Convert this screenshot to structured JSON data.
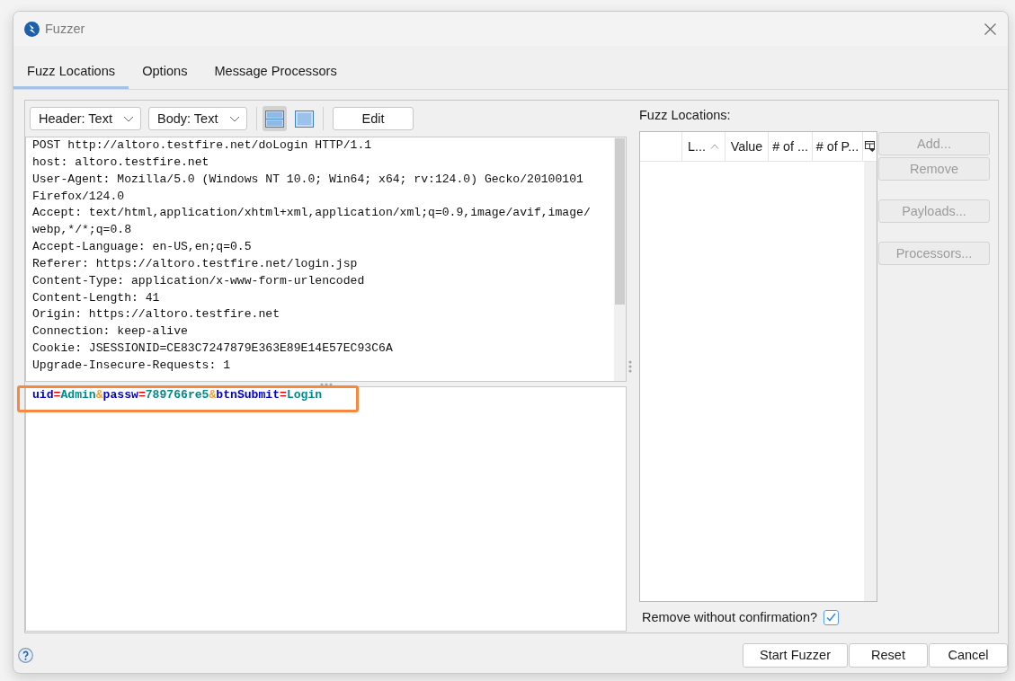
{
  "window": {
    "title": "Fuzzer"
  },
  "tabs": [
    {
      "label": "Fuzz Locations",
      "selected": true
    },
    {
      "label": "Options",
      "selected": false
    },
    {
      "label": "Message Processors",
      "selected": false
    }
  ],
  "toolbar": {
    "dropdowns": [
      {
        "value": "Header: Text"
      },
      {
        "value": "Body: Text"
      }
    ],
    "view_toggles": [
      {
        "kind": "split",
        "selected": true
      },
      {
        "kind": "single",
        "selected": false
      }
    ],
    "edit_button": "Edit"
  },
  "request": {
    "header_lines": [
      "POST http://altoro.testfire.net/doLogin HTTP/1.1",
      "host: altoro.testfire.net",
      "User-Agent: Mozilla/5.0 (Windows NT 10.0; Win64; x64; rv:124.0) Gecko/20100101",
      "Firefox/124.0",
      "Accept: text/html,application/xhtml+xml,application/xml;q=0.9,image/avif,image/",
      "webp,*/*;q=0.8",
      "Accept-Language: en-US,en;q=0.5",
      "Referer: https://altoro.testfire.net/login.jsp",
      "Content-Type: application/x-www-form-urlencoded",
      "Content-Length: 41",
      "Origin: https://altoro.testfire.net",
      "Connection: keep-alive",
      "Cookie: JSESSIONID=CE83C7247879E363E89E14E57EC93C6A",
      "Upgrade-Insecure-Requests: 1"
    ],
    "body": {
      "highlighted": true,
      "tokens": [
        {
          "kind": "name",
          "text": "uid"
        },
        {
          "kind": "equals",
          "text": "="
        },
        {
          "kind": "value",
          "text": "Admin"
        },
        {
          "kind": "separator",
          "text": "&"
        },
        {
          "kind": "name",
          "text": "passw"
        },
        {
          "kind": "equals",
          "text": "="
        },
        {
          "kind": "value",
          "text": "789766re5"
        },
        {
          "kind": "separator",
          "text": "&"
        },
        {
          "kind": "name",
          "text": "btnSubmit"
        },
        {
          "kind": "equals",
          "text": "="
        },
        {
          "kind": "value",
          "text": "Login"
        }
      ]
    }
  },
  "fuzz_locations": {
    "label": "Fuzz Locations:",
    "table": {
      "columns": [
        {
          "sorted": false
        },
        {
          "label": "L...",
          "sorted": true
        },
        {
          "label": "Value",
          "sorted": false
        },
        {
          "label": "# of ...",
          "sorted": false
        },
        {
          "label": "# of P...",
          "sorted": false
        }
      ]
    },
    "buttons": [
      {
        "label": "Add...",
        "disabled": true
      },
      {
        "label": "Remove",
        "disabled": true
      },
      {
        "label": "Payloads...",
        "disabled": true
      },
      {
        "label": "Processors...",
        "disabled": true
      }
    ],
    "remove_without_confirmation": {
      "label": "Remove without confirmation?",
      "checked": true
    }
  },
  "footer_buttons": [
    {
      "label": "Start Fuzzer"
    },
    {
      "label": "Reset"
    },
    {
      "label": "Cancel"
    }
  ]
}
